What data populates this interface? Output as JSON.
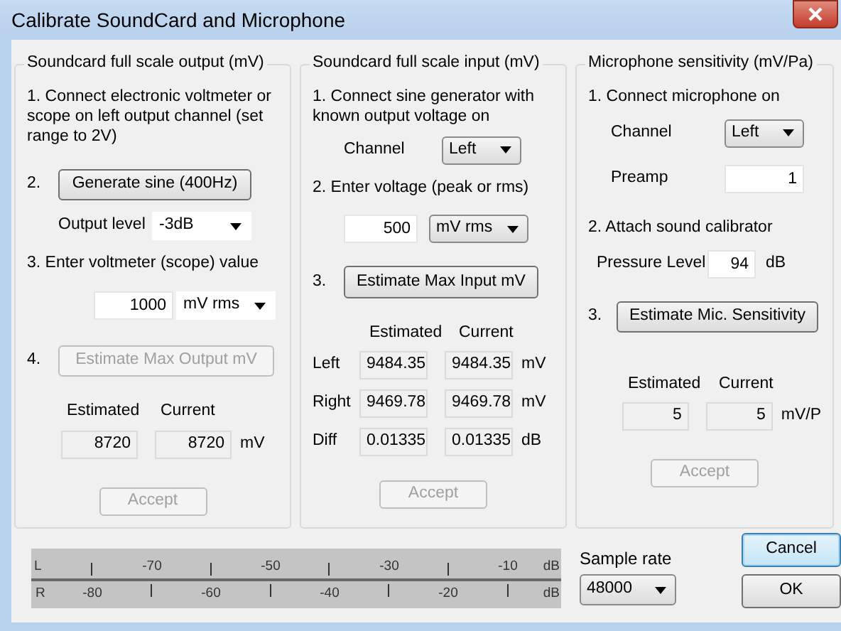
{
  "window": {
    "title": "Calibrate SoundCard and Microphone"
  },
  "output_group": {
    "title": "Soundcard full scale output (mV)",
    "step1": "1. Connect electronic voltmeter or scope on left output channel (set range  to 2V)",
    "step2_number": "2.",
    "generate_button": {
      "label": "Generate sine (400Hz)",
      "disabled": false
    },
    "output_level_label": "Output level",
    "output_level_value": "-3dB",
    "step3": "3. Enter voltmeter (scope) value",
    "voltmeter_value": "1000",
    "voltmeter_unit": "mV rms",
    "step4_number": "4.",
    "estimate_button": {
      "label": "Estimate Max Output mV",
      "disabled": true
    },
    "estimated_header": "Estimated",
    "current_header": "Current",
    "estimated": "8720",
    "current": "8720",
    "unit": "mV",
    "accept_button": {
      "label": "Accept",
      "disabled": true
    }
  },
  "input_group": {
    "title": "Soundcard full scale  input (mV)",
    "step1": "1. Connect sine generator with known output voltage on",
    "channel_label": "Channel",
    "channel_value": "Left",
    "step2": "2. Enter voltage (peak or rms)",
    "voltage_value": "500",
    "voltage_unit": "mV rms",
    "step3_number": "3.",
    "estimate_button": {
      "label": "Estimate Max Input mV",
      "disabled": false
    },
    "estimated_header": "Estimated",
    "current_header": "Current",
    "rows": [
      {
        "label": "Left",
        "estimated": "9484.35",
        "current": "9484.35",
        "unit": "mV"
      },
      {
        "label": "Right",
        "estimated": "9469.78",
        "current": "9469.78",
        "unit": "mV"
      },
      {
        "label": "Diff",
        "estimated": "0.01335",
        "current": "0.01335",
        "unit": "dB"
      }
    ],
    "accept_button": {
      "label": "Accept",
      "disabled": true
    }
  },
  "mic_group": {
    "title": "Microphone sensitivity (mV/Pa)",
    "step1": "1. Connect microphone on",
    "channel_label": "Channel",
    "channel_value": "Left",
    "preamp_label": "Preamp",
    "preamp_value": "1",
    "step2": "2. Attach sound calibrator",
    "pressure_label": "Pressure Level",
    "pressure_value": "94",
    "pressure_unit": "dB",
    "step3_number": "3.",
    "estimate_button": {
      "label": "Estimate Mic. Sensitivity",
      "disabled": false
    },
    "estimated_header": "Estimated",
    "current_header": "Current",
    "estimated": "5",
    "current": "5",
    "unit": "mV/P",
    "accept_button": {
      "label": "Accept",
      "disabled": true
    }
  },
  "level_meter": {
    "left_label": "L",
    "left_ticks": [
      "-70",
      "-50",
      "-30",
      "-10"
    ],
    "left_unit": "dB",
    "right_label": "R",
    "right_ticks": [
      "-80",
      "-60",
      "-40",
      "-20"
    ],
    "right_unit": "dB"
  },
  "sample_rate": {
    "label": "Sample rate",
    "value": "48000"
  },
  "buttons": [
    {
      "label": "Cancel",
      "default": true
    },
    {
      "label": "OK",
      "default": false
    }
  ]
}
